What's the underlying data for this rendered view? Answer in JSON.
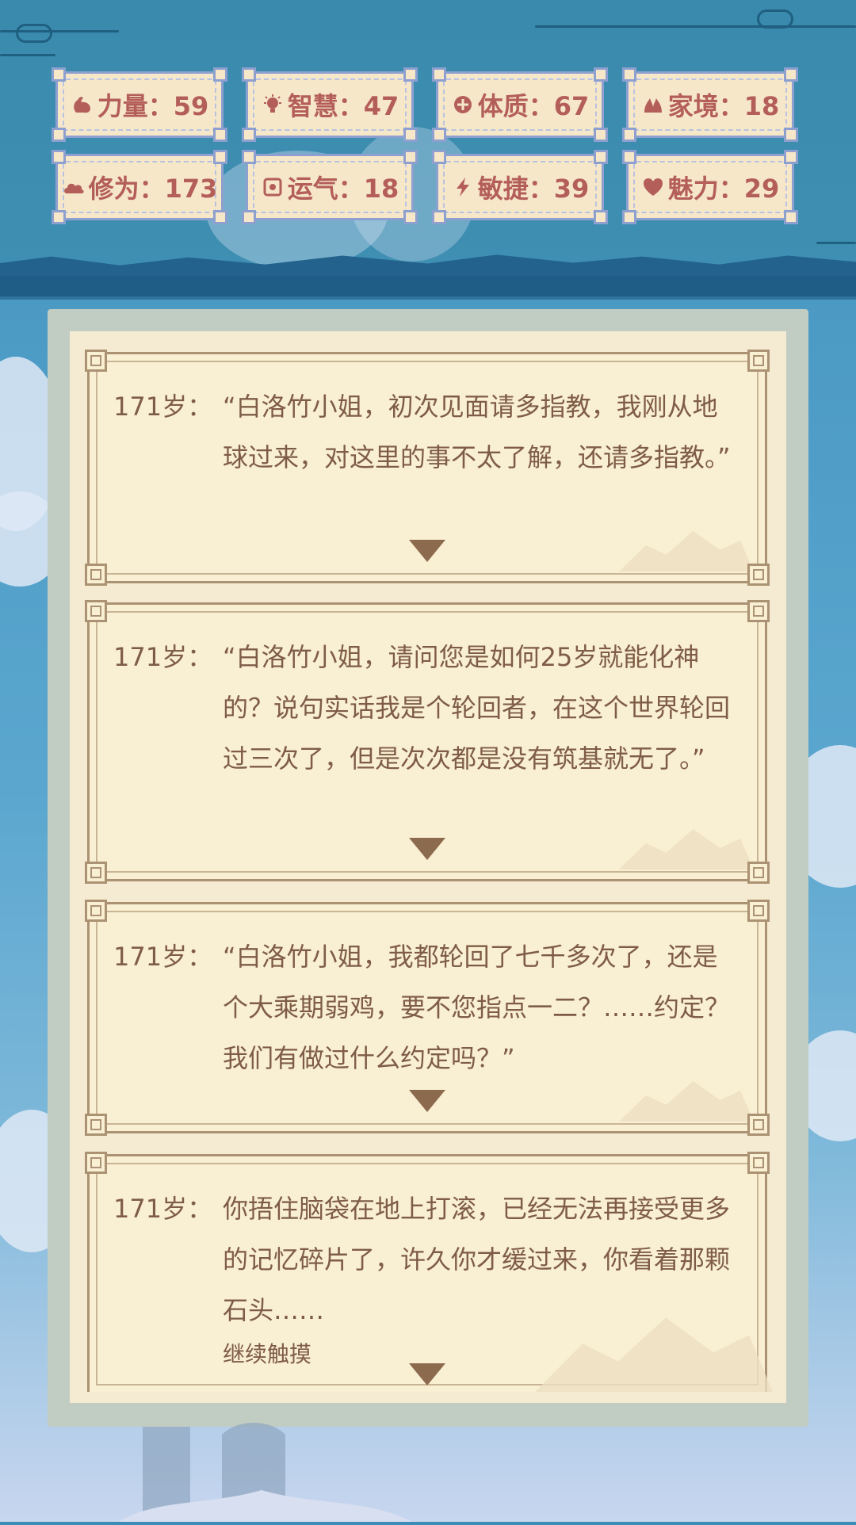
{
  "stats": [
    {
      "icon": "arm-icon",
      "label": "力量：59"
    },
    {
      "icon": "bulb-icon",
      "label": "智慧：47"
    },
    {
      "icon": "body-icon",
      "label": "体质：67"
    },
    {
      "icon": "family-icon",
      "label": "家境：18"
    },
    {
      "icon": "cloud-icon",
      "label": "修为：173"
    },
    {
      "icon": "luck-icon",
      "label": "运气：18"
    },
    {
      "icon": "lightning-icon",
      "label": "敏捷：39"
    },
    {
      "icon": "heart-icon",
      "label": "魅力：29"
    }
  ],
  "events": [
    {
      "age": "171岁：",
      "text": "“白洛竹小姐，初次见面请多指教，我刚从地球过来，对这里的事不太了解，还请多指教。”"
    },
    {
      "age": "171岁：",
      "text": "“白洛竹小姐，请问您是如何25岁就能化神的？说句实话我是个轮回者，在这个世界轮回过三次了，但是次次都是没有筑基就无了。”"
    },
    {
      "age": "171岁：",
      "text": "“白洛竹小姐，我都轮回了七千多次了，还是个大乘期弱鸡，要不您指点一二？……约定？我们有做过什么约定吗？”"
    },
    {
      "age": "171岁：",
      "text": "你捂住脑袋在地上打滚，已经无法再接受更多的记忆碎片了，许久你才缓过来，你看着那颗石头……",
      "sub": "继续触摸"
    }
  ],
  "colors": {
    "stat_text": "#b45e5a",
    "card_text": "#7f5c47",
    "card_border": "#ab9273"
  }
}
